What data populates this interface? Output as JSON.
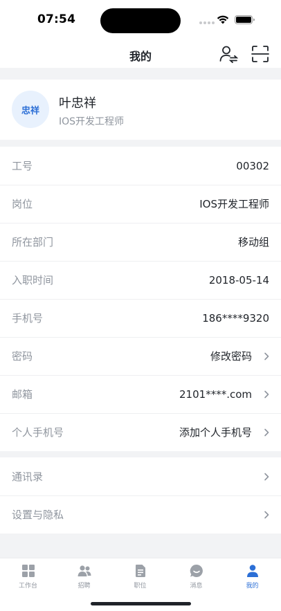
{
  "status_bar": {
    "time": "07:54"
  },
  "nav": {
    "title": "我的"
  },
  "profile": {
    "avatar_text": "忠祥",
    "name": "叶忠祥",
    "title": "IOS开发工程师"
  },
  "info_rows": [
    {
      "label": "工号",
      "value": "00302"
    },
    {
      "label": "岗位",
      "value": "IOS开发工程师"
    },
    {
      "label": "所在部门",
      "value": "移动组"
    },
    {
      "label": "入职时间",
      "value": "2018-05-14"
    },
    {
      "label": "手机号",
      "value": "186****9320"
    },
    {
      "label": "密码",
      "value": "修改密码"
    },
    {
      "label": "邮箱",
      "value": "2101****.com"
    },
    {
      "label": "个人手机号",
      "value": "添加个人手机号"
    }
  ],
  "more_rows": [
    {
      "label": "通讯录"
    },
    {
      "label": "设置与隐私"
    }
  ],
  "tabs": [
    {
      "label": "工作台",
      "icon": "grid-icon"
    },
    {
      "label": "招聘",
      "icon": "people-icon"
    },
    {
      "label": "职位",
      "icon": "document-icon"
    },
    {
      "label": "消息",
      "icon": "chat-icon"
    },
    {
      "label": "我的",
      "icon": "person-icon",
      "active": true
    }
  ],
  "colors": {
    "accent": "#2c6fd6",
    "background": "#f2f3f5",
    "secondary_text": "#8f959e",
    "primary_text": "#1f2329"
  }
}
